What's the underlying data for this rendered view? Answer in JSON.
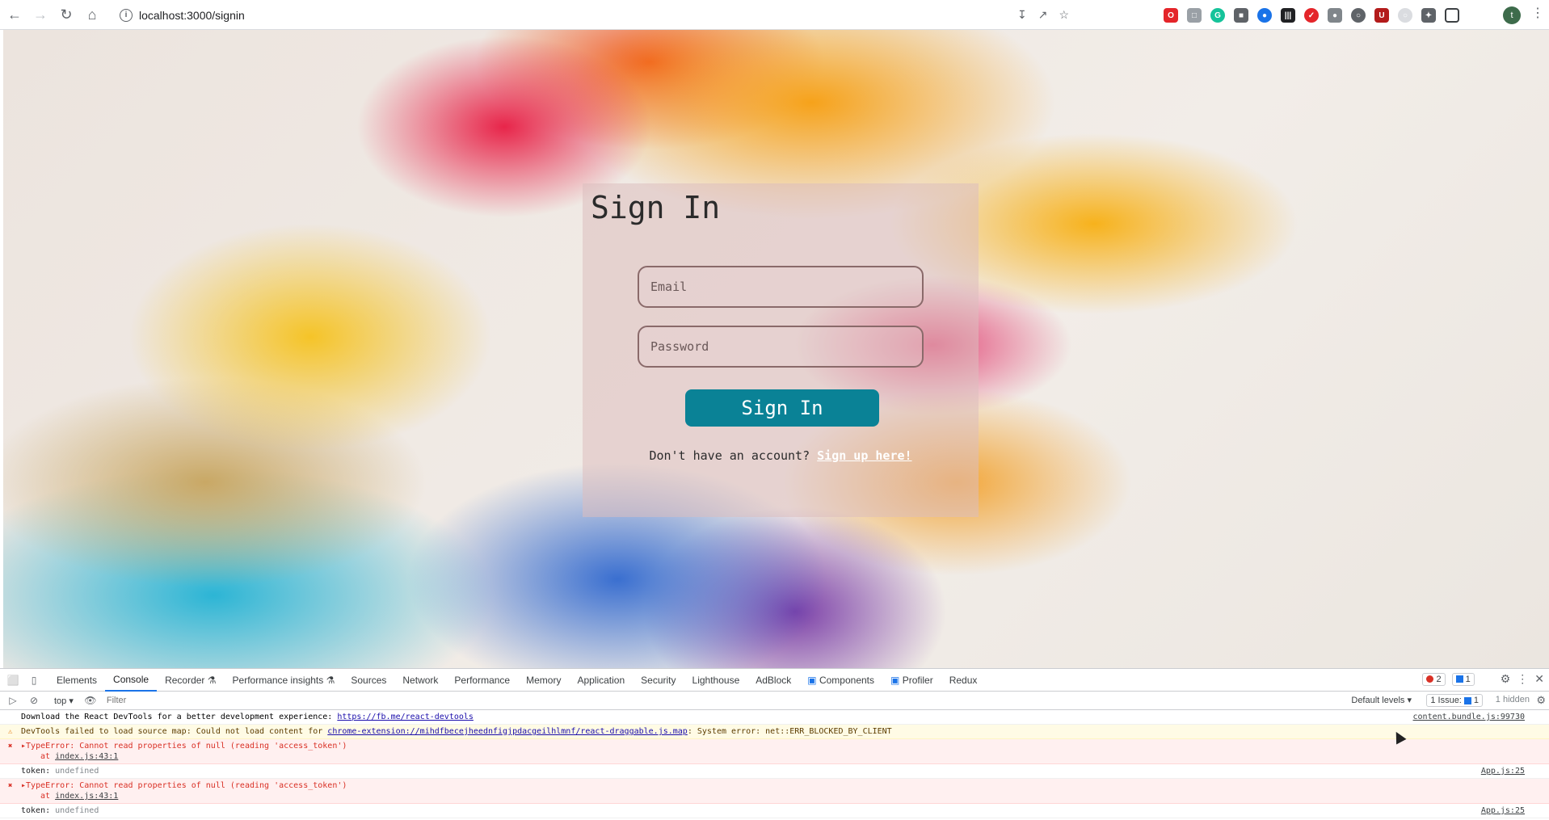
{
  "browser": {
    "url": "localhost:3000/signin",
    "profile_initial": "t"
  },
  "signin": {
    "title": "Sign In",
    "email_placeholder": "Email",
    "password_placeholder": "Password",
    "button_label": "Sign In",
    "signup_prompt": "Don't have an account?",
    "signup_link": "Sign up here!"
  },
  "devtools": {
    "tabs": [
      "Elements",
      "Console",
      "Recorder",
      "Performance insights",
      "Sources",
      "Network",
      "Performance",
      "Memory",
      "Application",
      "Security",
      "Lighthouse",
      "AdBlock",
      "Components",
      "Profiler",
      "Redux"
    ],
    "active_tab": "Console",
    "error_count": "2",
    "message_count": "1",
    "context": "top",
    "filter_placeholder": "Filter",
    "levels": "Default levels",
    "issues_label": "1 Issue:",
    "issues_count": "1",
    "hidden": "1 hidden",
    "messages": {
      "m0_text": "Download the React DevTools for a better development experience: ",
      "m0_link": "https://fb.me/react-devtools",
      "m0_src": "content.bundle.js:99730",
      "m1_pre": "DevTools failed to load source map: Could not load content for ",
      "m1_link": "chrome-extension://mihdfbecejheednfigjpdacgeilhlmnf/react-draggable.js.map",
      "m1_post": ": System error: net::ERR_BLOCKED_BY_CLIENT",
      "m2_text": "TypeError: Cannot read properties of null (reading 'access_token')",
      "m2_at": "at ",
      "m2_loc": "index.js:43:1",
      "m3_label": "token: ",
      "m3_value": "undefined",
      "m3_src": "App.js:25",
      "m4_text": "TypeError: Cannot read properties of null (reading 'access_token')",
      "m4_at": "at ",
      "m4_loc": "index.js:43:1",
      "m5_label": "token: ",
      "m5_value": "undefined",
      "m5_src": "App.js:25"
    }
  },
  "colors": {
    "primary_button": "#0a8296",
    "error": "#d93025",
    "link": "#1a0dab"
  }
}
